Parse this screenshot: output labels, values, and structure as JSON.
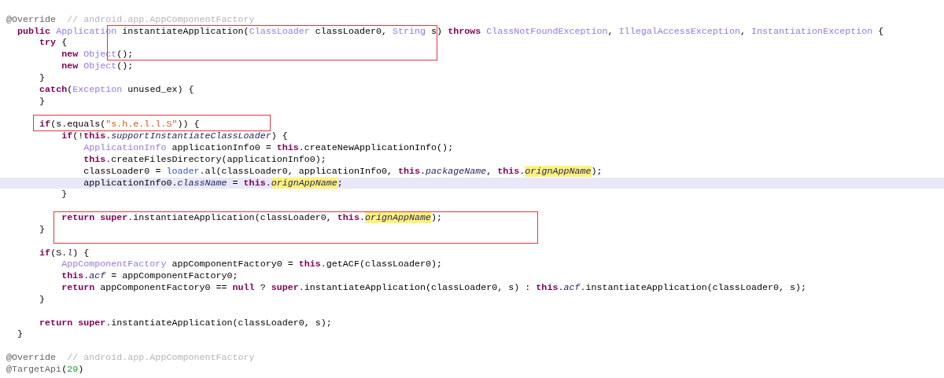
{
  "editor": {
    "lines": [
      {
        "kind": "blank"
      },
      {
        "kind": "code",
        "tokens": [
          {
            "kind": "annotation",
            "text": "@Override"
          },
          {
            "kind": "comment",
            "text": "  // android.app.AppComponentFactory"
          }
        ]
      },
      {
        "kind": "code",
        "tokens": [
          {
            "kind": "keyword",
            "text": "  public "
          },
          {
            "kind": "type",
            "text": "Application"
          },
          {
            "kind": "plain",
            "text": " instantiateApplication("
          },
          {
            "kind": "type",
            "text": "ClassLoader"
          },
          {
            "kind": "plain",
            "text": " classLoader0, "
          },
          {
            "kind": "type",
            "text": "String"
          },
          {
            "kind": "plain",
            "text": " s) "
          },
          {
            "kind": "keyword",
            "text": "throws "
          },
          {
            "kind": "type",
            "text": "ClassNotFoundException"
          },
          {
            "kind": "plain",
            "text": ", "
          },
          {
            "kind": "type",
            "text": "IllegalAccessException"
          },
          {
            "kind": "plain",
            "text": ", "
          },
          {
            "kind": "type",
            "text": "InstantiationException"
          },
          {
            "kind": "plain",
            "text": " {"
          }
        ]
      },
      {
        "kind": "code",
        "tokens": [
          {
            "kind": "keyword",
            "text": "      try"
          },
          {
            "kind": "plain",
            "text": " {"
          }
        ]
      },
      {
        "kind": "code",
        "tokens": [
          {
            "kind": "keyword",
            "text": "          new "
          },
          {
            "kind": "type",
            "text": "Object"
          },
          {
            "kind": "plain",
            "text": "();"
          }
        ]
      },
      {
        "kind": "code",
        "tokens": [
          {
            "kind": "keyword",
            "text": "          new "
          },
          {
            "kind": "type",
            "text": "Object"
          },
          {
            "kind": "plain",
            "text": "();"
          }
        ]
      },
      {
        "kind": "code",
        "tokens": [
          {
            "kind": "plain",
            "text": "      }"
          }
        ]
      },
      {
        "kind": "code",
        "tokens": [
          {
            "kind": "keyword",
            "text": "      catch"
          },
          {
            "kind": "plain",
            "text": "("
          },
          {
            "kind": "type",
            "text": "Exception"
          },
          {
            "kind": "plain",
            "text": " unused_ex) {"
          }
        ]
      },
      {
        "kind": "code",
        "tokens": [
          {
            "kind": "plain",
            "text": "      }"
          }
        ]
      },
      {
        "kind": "blank"
      },
      {
        "kind": "code",
        "tokens": [
          {
            "kind": "keyword",
            "text": "      if"
          },
          {
            "kind": "plain",
            "text": "(s.equals("
          },
          {
            "kind": "string",
            "text": "\"s.h.e.l.l.S\""
          },
          {
            "kind": "plain",
            "text": ")) {"
          }
        ]
      },
      {
        "kind": "code",
        "tokens": [
          {
            "kind": "keyword",
            "text": "          if"
          },
          {
            "kind": "plain",
            "text": "(!"
          },
          {
            "kind": "keyword",
            "text": "this"
          },
          {
            "kind": "plain",
            "text": "."
          },
          {
            "kind": "field",
            "text": "supportInstantiateClassLoader"
          },
          {
            "kind": "plain",
            "text": ") {"
          }
        ]
      },
      {
        "kind": "code",
        "tokens": [
          {
            "kind": "type",
            "text": "              ApplicationInfo"
          },
          {
            "kind": "plain",
            "text": " applicationInfo0 = "
          },
          {
            "kind": "keyword",
            "text": "this"
          },
          {
            "kind": "plain",
            "text": ".createNewApplicationInfo();"
          }
        ]
      },
      {
        "kind": "code",
        "tokens": [
          {
            "kind": "keyword",
            "text": "              this"
          },
          {
            "kind": "plain",
            "text": ".createFilesDirectory(applicationInfo0);"
          }
        ]
      },
      {
        "kind": "code",
        "tokens": [
          {
            "kind": "plain",
            "text": "              classLoader0 = "
          },
          {
            "kind": "reference",
            "text": "loader"
          },
          {
            "kind": "plain",
            "text": ".al(classLoader0, applicationInfo0, "
          },
          {
            "kind": "keyword",
            "text": "this"
          },
          {
            "kind": "plain",
            "text": "."
          },
          {
            "kind": "field",
            "text": "packageName"
          },
          {
            "kind": "plain",
            "text": ", "
          },
          {
            "kind": "keyword",
            "text": "this"
          },
          {
            "kind": "plain",
            "text": "."
          },
          {
            "kind": "occurrence",
            "text": "orignAppName"
          },
          {
            "kind": "plain",
            "text": ");"
          }
        ]
      },
      {
        "kind": "code",
        "current": true,
        "tokens": [
          {
            "kind": "plain",
            "text": "              applicationInfo0."
          },
          {
            "kind": "field",
            "text": "className"
          },
          {
            "kind": "plain",
            "text": " = "
          },
          {
            "kind": "keyword",
            "text": "this"
          },
          {
            "kind": "plain",
            "text": "."
          },
          {
            "kind": "occurrence",
            "text": "orignAppName"
          },
          {
            "kind": "plain",
            "text": ";"
          }
        ]
      },
      {
        "kind": "code",
        "tokens": [
          {
            "kind": "plain",
            "text": "          }"
          }
        ]
      },
      {
        "kind": "blank"
      },
      {
        "kind": "code",
        "tokens": [
          {
            "kind": "keyword",
            "text": "          return super"
          },
          {
            "kind": "plain",
            "text": ".instantiateApplication(classLoader0, "
          },
          {
            "kind": "keyword",
            "text": "this"
          },
          {
            "kind": "plain",
            "text": "."
          },
          {
            "kind": "occurrence",
            "text": "orignAppName"
          },
          {
            "kind": "plain",
            "text": ");"
          }
        ]
      },
      {
        "kind": "code",
        "tokens": [
          {
            "kind": "plain",
            "text": "      }"
          }
        ]
      },
      {
        "kind": "blank"
      },
      {
        "kind": "code",
        "tokens": [
          {
            "kind": "keyword",
            "text": "      if"
          },
          {
            "kind": "plain",
            "text": "(S."
          },
          {
            "kind": "field",
            "text": "l"
          },
          {
            "kind": "plain",
            "text": ") {"
          }
        ]
      },
      {
        "kind": "code",
        "tokens": [
          {
            "kind": "type",
            "text": "          AppComponentFactory"
          },
          {
            "kind": "plain",
            "text": " appComponentFactory0 = "
          },
          {
            "kind": "keyword",
            "text": "this"
          },
          {
            "kind": "plain",
            "text": ".getACF(classLoader0);"
          }
        ]
      },
      {
        "kind": "code",
        "tokens": [
          {
            "kind": "keyword",
            "text": "          this"
          },
          {
            "kind": "plain",
            "text": "."
          },
          {
            "kind": "field",
            "text": "acf"
          },
          {
            "kind": "plain",
            "text": " = appComponentFactory0;"
          }
        ]
      },
      {
        "kind": "code",
        "tokens": [
          {
            "kind": "keyword",
            "text": "          return"
          },
          {
            "kind": "plain",
            "text": " appComponentFactory0 == "
          },
          {
            "kind": "keyword",
            "text": "null"
          },
          {
            "kind": "plain",
            "text": " ? "
          },
          {
            "kind": "keyword",
            "text": "super"
          },
          {
            "kind": "plain",
            "text": ".instantiateApplication(classLoader0, s) : "
          },
          {
            "kind": "keyword",
            "text": "this"
          },
          {
            "kind": "plain",
            "text": "."
          },
          {
            "kind": "field",
            "text": "acf"
          },
          {
            "kind": "plain",
            "text": ".instantiateApplication(classLoader0, s);"
          }
        ]
      },
      {
        "kind": "code",
        "tokens": [
          {
            "kind": "plain",
            "text": "      }"
          }
        ]
      },
      {
        "kind": "blank"
      },
      {
        "kind": "code",
        "tokens": [
          {
            "kind": "keyword",
            "text": "      return super"
          },
          {
            "kind": "plain",
            "text": ".instantiateApplication(classLoader0, s);"
          }
        ]
      },
      {
        "kind": "code",
        "tokens": [
          {
            "kind": "plain",
            "text": "  }"
          }
        ]
      },
      {
        "kind": "blank"
      },
      {
        "kind": "code",
        "tokens": [
          {
            "kind": "annotation",
            "text": "@Override"
          },
          {
            "kind": "comment",
            "text": "  // android.app.AppComponentFactory"
          }
        ]
      },
      {
        "kind": "code",
        "tokens": [
          {
            "kind": "annotation",
            "text": "@TargetApi"
          },
          {
            "kind": "plain",
            "text": "("
          },
          {
            "kind": "number",
            "text": "29"
          },
          {
            "kind": "plain",
            "text": ")"
          }
        ]
      }
    ]
  }
}
